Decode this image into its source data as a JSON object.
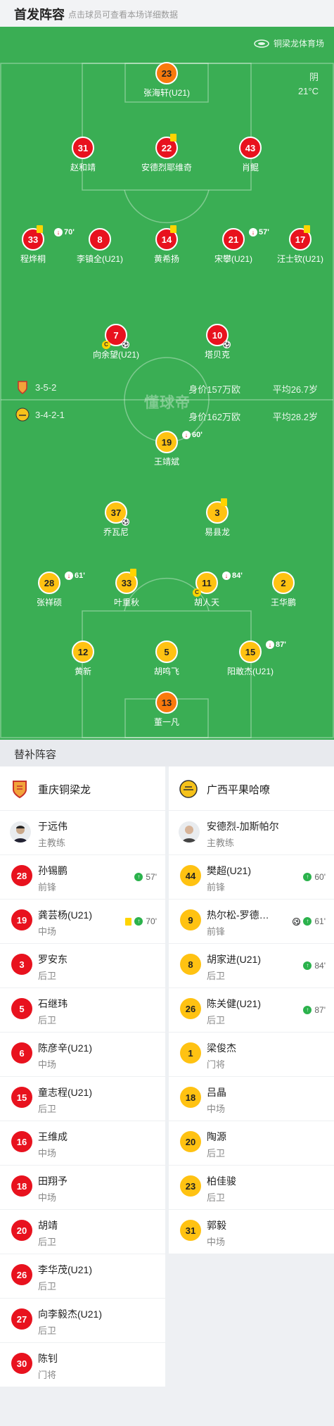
{
  "header": {
    "title": "首发阵容",
    "hint": "点击球员可查看本场详细数据"
  },
  "venue": "铜梁龙体育场",
  "weather": {
    "cond": "阴",
    "temp": "21°C"
  },
  "watermark": "懂球帝",
  "home": {
    "formation": "3-5-2",
    "value": "身价157万欧",
    "avg": "平均26.7岁",
    "color": "#e8121e"
  },
  "away": {
    "formation": "3-4-2-1",
    "value": "身价162万欧",
    "avg": "平均28.2岁",
    "color": "#ffc212"
  },
  "home_players": [
    {
      "num": "23",
      "name": "张海轩(U21)",
      "keeper": true
    },
    {
      "num": "31",
      "name": "赵和靖"
    },
    {
      "num": "22",
      "name": "安德烈耶维奇",
      "card": "yellow"
    },
    {
      "num": "43",
      "name": "肖鲲"
    },
    {
      "num": "33",
      "name": "程烨桐",
      "card": "yellow",
      "sub": "70'"
    },
    {
      "num": "8",
      "name": "李镇全(U21)"
    },
    {
      "num": "14",
      "name": "黄希扬",
      "card": "yellow"
    },
    {
      "num": "21",
      "name": "宋攀(U21)",
      "sub": "57'"
    },
    {
      "num": "17",
      "name": "汪士钦(U21)",
      "card": "yellow"
    },
    {
      "num": "7",
      "name": "向余望(U21)",
      "captain": "C",
      "goal": true
    },
    {
      "num": "10",
      "name": "塔贝克",
      "goal": true
    }
  ],
  "away_players": [
    {
      "num": "19",
      "name": "王靖斌",
      "sub": "60'"
    },
    {
      "num": "37",
      "name": "乔瓦尼",
      "goal": true
    },
    {
      "num": "3",
      "name": "易县龙",
      "card": "yellow"
    },
    {
      "num": "28",
      "name": "张祥硕",
      "sub": "61'"
    },
    {
      "num": "33",
      "name": "叶重秋",
      "card": "yellow"
    },
    {
      "num": "11",
      "name": "胡人天",
      "sub": "84'",
      "captain": "C"
    },
    {
      "num": "2",
      "name": "王华鹏"
    },
    {
      "num": "12",
      "name": "黄新"
    },
    {
      "num": "5",
      "name": "胡鸣飞"
    },
    {
      "num": "15",
      "name": "阳敢杰(U21)",
      "sub": "87'"
    },
    {
      "num": "13",
      "name": "董一凡",
      "keeper": true
    }
  ],
  "subs_title": "替补阵容",
  "home_subs": {
    "team": "重庆铜梁龙",
    "coach": {
      "name": "于远伟",
      "role": "主教练"
    },
    "list": [
      {
        "num": "28",
        "name": "孙锡鹏",
        "pos": "前锋",
        "in": "57'"
      },
      {
        "num": "19",
        "name": "龚芸杨(U21)",
        "pos": "中场",
        "card": "yellow",
        "in": "70'"
      },
      {
        "num": "3",
        "name": "罗安东",
        "pos": "后卫"
      },
      {
        "num": "5",
        "name": "石继玮",
        "pos": "后卫"
      },
      {
        "num": "6",
        "name": "陈彦辛(U21)",
        "pos": "中场"
      },
      {
        "num": "15",
        "name": "童志程(U21)",
        "pos": "后卫"
      },
      {
        "num": "16",
        "name": "王维成",
        "pos": "中场"
      },
      {
        "num": "18",
        "name": "田翔予",
        "pos": "中场"
      },
      {
        "num": "20",
        "name": "胡靖",
        "pos": "后卫"
      },
      {
        "num": "26",
        "name": "李华茂(U21)",
        "pos": "后卫"
      },
      {
        "num": "27",
        "name": "向李毅杰(U21)",
        "pos": "后卫"
      },
      {
        "num": "30",
        "name": "陈钊",
        "pos": "门将"
      }
    ]
  },
  "away_subs": {
    "team": "广西平果哈嘹",
    "coach": {
      "name": "安德烈-加斯帕尔",
      "role": "主教练"
    },
    "list": [
      {
        "num": "44",
        "name": "樊超(U21)",
        "pos": "前锋",
        "in": "60'"
      },
      {
        "num": "9",
        "name": "热尔松-罗德…",
        "pos": "前锋",
        "goal": true,
        "in": "61'"
      },
      {
        "num": "8",
        "name": "胡家进(U21)",
        "pos": "后卫",
        "in": "84'"
      },
      {
        "num": "26",
        "name": "陈关健(U21)",
        "pos": "后卫",
        "in": "87'"
      },
      {
        "num": "1",
        "name": "梁俊杰",
        "pos": "门将"
      },
      {
        "num": "18",
        "name": "吕晶",
        "pos": "中场"
      },
      {
        "num": "20",
        "name": "陶源",
        "pos": "后卫"
      },
      {
        "num": "23",
        "name": "柏佳骏",
        "pos": "后卫"
      },
      {
        "num": "31",
        "name": "郭毅",
        "pos": "中场"
      }
    ]
  }
}
